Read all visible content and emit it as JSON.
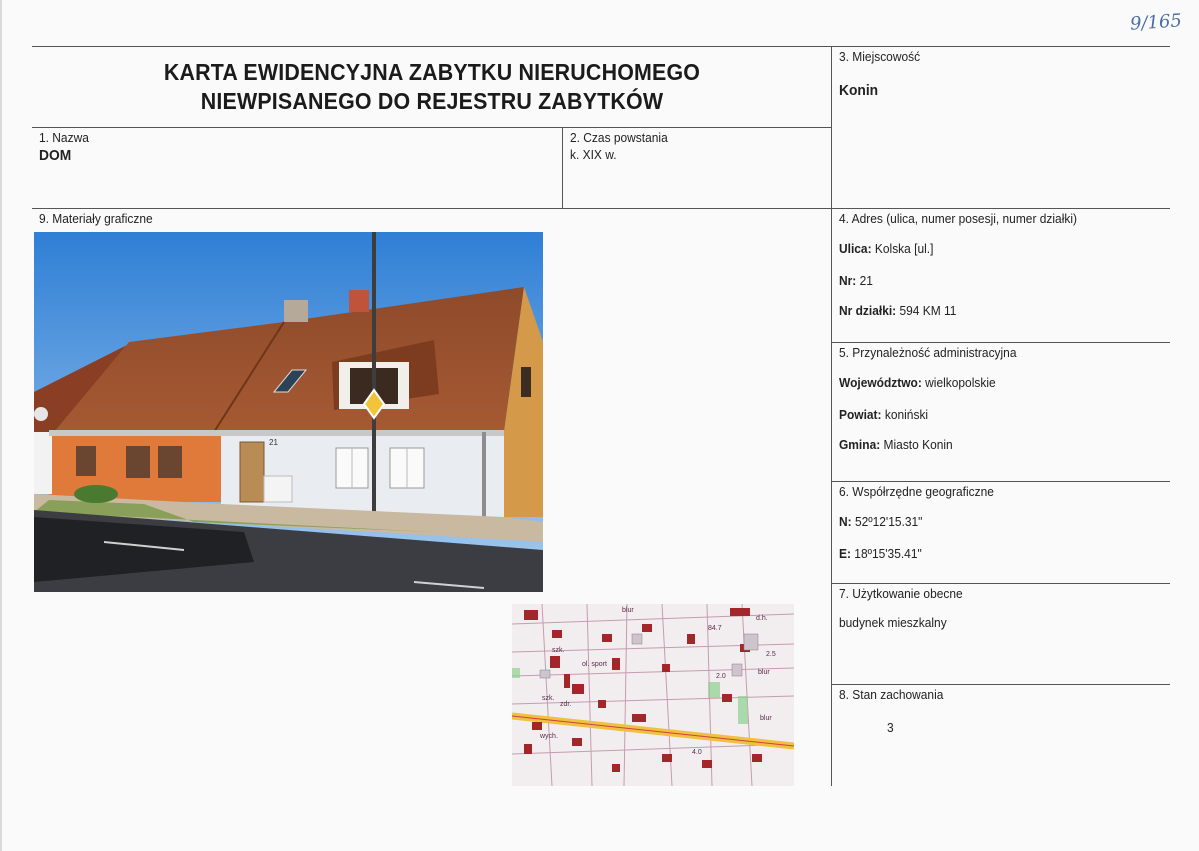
{
  "header": {
    "title_line1": "KARTA EWIDENCYJNA ZABYTKU NIERUCHOMEGO",
    "title_line2": "NIEWPISANEGO DO REJESTRU ZABYTKÓW",
    "handwritten_number": "9/165"
  },
  "sections": {
    "name": {
      "label": "1. Nazwa",
      "value": "DOM"
    },
    "date": {
      "label": "2. Czas powstania",
      "value": "k. XIX w."
    },
    "locality": {
      "label": "3. Miejscowość",
      "value": "Konin"
    },
    "address": {
      "label": "4. Adres (ulica, numer posesji, numer działki)",
      "street_key": "Ulica:",
      "street_val": "Kolska [ul.]",
      "nr_key": "Nr:",
      "nr_val": "21",
      "plot_key": "Nr działki:",
      "plot_val": "594 KM 11"
    },
    "admin": {
      "label": "5. Przynależność administracyjna",
      "voiv_key": "Województwo:",
      "voiv_val": "wielkopolskie",
      "county_key": "Powiat:",
      "county_val": "koniński",
      "commune_key": "Gmina:",
      "commune_val": "Miasto Konin"
    },
    "coords": {
      "label": "6. Współrzędne geograficzne",
      "n_key": "N:",
      "n_val": "52º12'15.31\"",
      "e_key": "E:",
      "e_val": "18º15'35.41\""
    },
    "usage": {
      "label": "7. Użytkowanie obecne",
      "value": "budynek mieszkalny"
    },
    "condition": {
      "label": "8. Stan zachowania",
      "value": "3"
    },
    "graphics": {
      "label": "9. Materiały graficzne"
    }
  },
  "photo": {
    "house_number": "21"
  },
  "map": {
    "labels": [
      "blur",
      "d.h.",
      "84.7",
      "szk.",
      "ol. sport",
      "szk.",
      "zdr.",
      "wych.",
      "blur",
      "blur",
      "2.5",
      "2.0",
      "4.0"
    ]
  }
}
